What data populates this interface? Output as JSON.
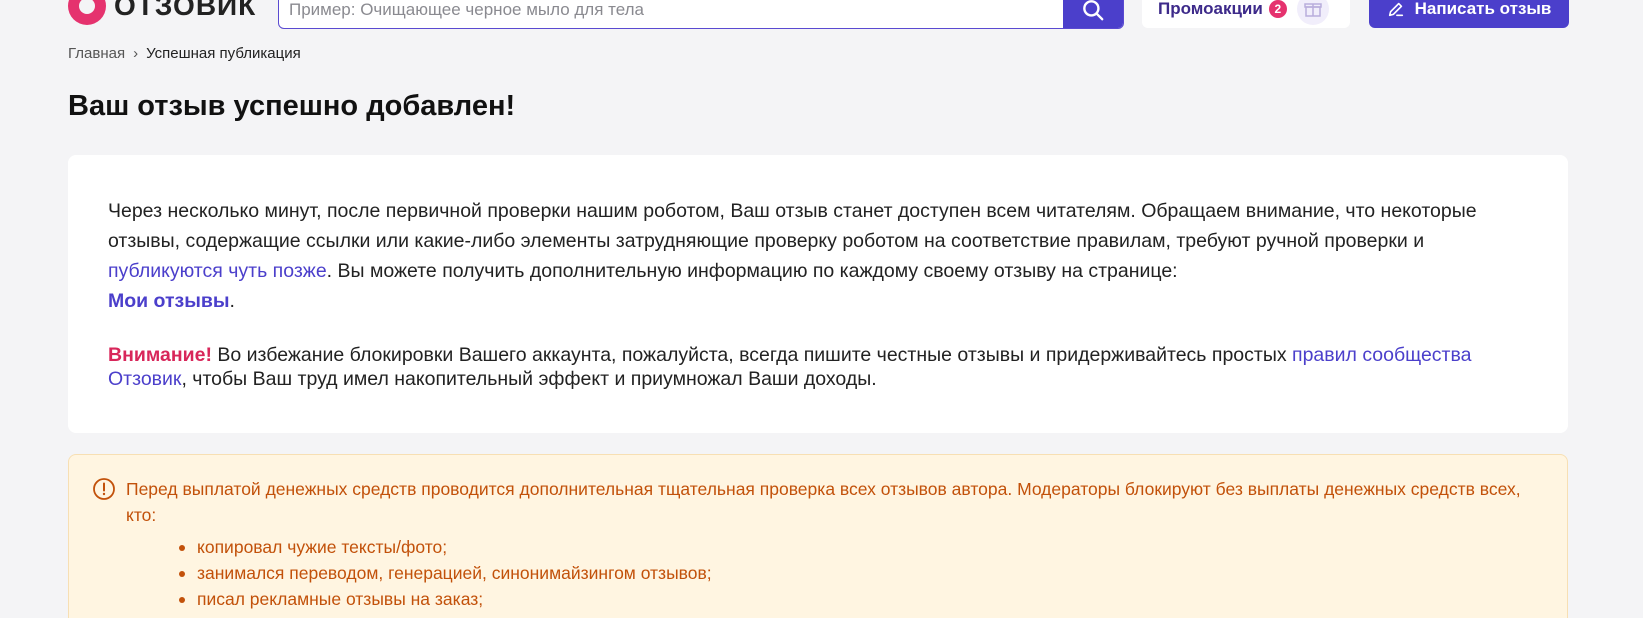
{
  "header": {
    "logo_text": "ОТЗОВИК",
    "search_placeholder": "Пример: Очищающее черное мыло для тела",
    "promo_label": "Промоакции",
    "promo_count": "2",
    "write_button": "Написать отзыв"
  },
  "breadcrumb": {
    "home": "Главная",
    "separator": "›",
    "current": "Успешная публикация"
  },
  "page_title": "Ваш отзыв успешно добавлен!",
  "card": {
    "p1_text1": "Через несколько минут, после первичной проверки нашим роботом, Ваш отзыв станет доступен всем читателям. Обращаем внимание, что некоторые отзывы, содержащие ссылки или какие-либо элементы затрудняющие проверку роботом на соответствие правилам, требуют ручной проверки и ",
    "p1_link1": "публикуются чуть позже",
    "p1_text2": ". Вы можете получить дополнительную информацию по каждому своему отзыву на странице: ",
    "p1_link2": "Мои отзывы",
    "p1_text3": ".",
    "p2_warning": "Внимание!",
    "p2_text1": " Во избежание блокировки Вашего аккаунта, пожалуйста, всегда пишите честные отзывы и придерживайтесь простых ",
    "p2_link": "правил сообщества Отзовик",
    "p2_text2": ", чтобы Ваш труд имел накопительный эффект и приумножал Ваши доходы."
  },
  "notice": {
    "text": "Перед выплатой денежных средств проводится дополнительная тщательная проверка всех отзывов автора. Модераторы блокируют без выплаты денежных средств всех, кто:",
    "items": [
      "копировал чужие тексты/фото;",
      "занимался переводом, генерацией, синонимайзингом отзывов;",
      "писал рекламные отзывы на заказ;"
    ]
  },
  "colors": {
    "accent": "#4b3fcb",
    "brand": "#e5326e",
    "warning_text": "#c2510a",
    "notice_bg": "#fff5e1"
  }
}
